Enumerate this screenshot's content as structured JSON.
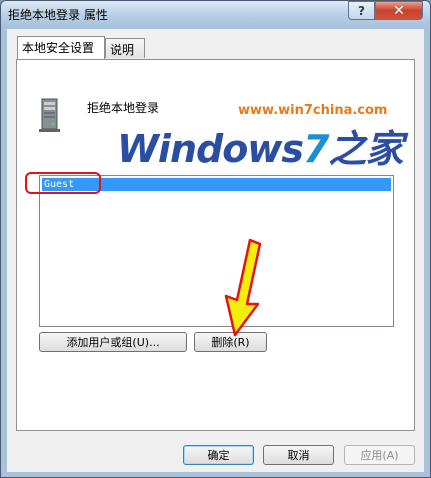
{
  "window": {
    "title": "拒绝本地登录 属性",
    "help_label": "?",
    "close_label": "✕"
  },
  "tabs": [
    {
      "label": "本地安全设置",
      "active": true
    },
    {
      "label": "说明",
      "active": false
    }
  ],
  "policy": {
    "name": "拒绝本地登录",
    "icon": "server-policy-icon"
  },
  "watermark": {
    "url": "www.win7china.com",
    "logo_main": "Windows",
    "logo_seven": "7",
    "logo_suffix": "之家"
  },
  "accounts": {
    "items": [
      "Guest"
    ],
    "selected": 0
  },
  "buttons": {
    "add": "添加用户或组(U)...",
    "remove": "删除(R)",
    "ok": "确定",
    "cancel": "取消",
    "apply": "应用(A)"
  },
  "colors": {
    "selection": "#3399ff",
    "annotation_red": "#e0121a",
    "annotation_arrow": "#f5ee0a"
  }
}
